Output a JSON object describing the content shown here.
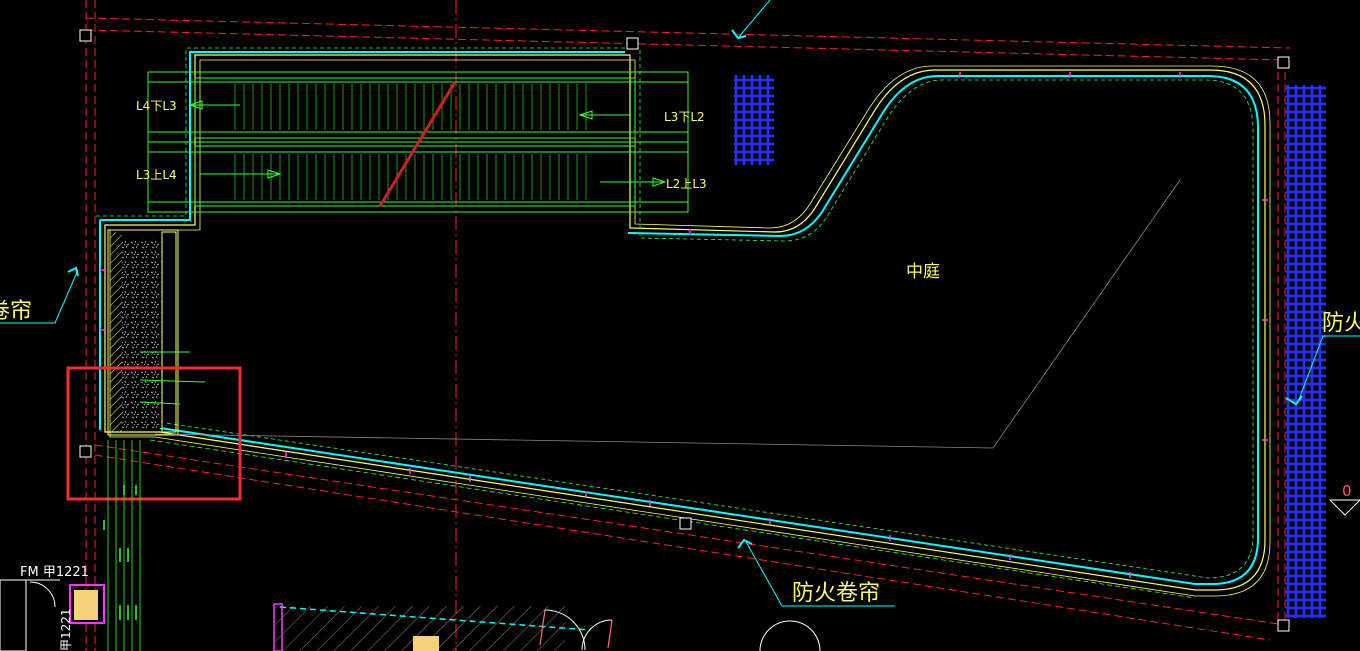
{
  "labels": {
    "escalator_1": "L4下L3",
    "escalator_2": "L3下L2",
    "escalator_3": "L3上L4",
    "escalator_4": "L2上L3",
    "atrium": "中庭",
    "fire_curtain_bottom": "防火卷帘",
    "fire_curtain_left": "卷帘",
    "fire_curtain_right": "防火",
    "door_tag": "FM 甲1221",
    "door_tag_vertical": "甲1221",
    "elevation_mark": "0"
  },
  "colors": {
    "background": "#000000",
    "outline_yellow": "#ffff66",
    "cyan": "#00ffff",
    "green": "#33ff33",
    "axis_red": "#ff2020",
    "highlight_box": "#ff2a2a",
    "grid_blue": "#2233ff",
    "magenta": "#ff33ff",
    "white": "#ffffff"
  }
}
